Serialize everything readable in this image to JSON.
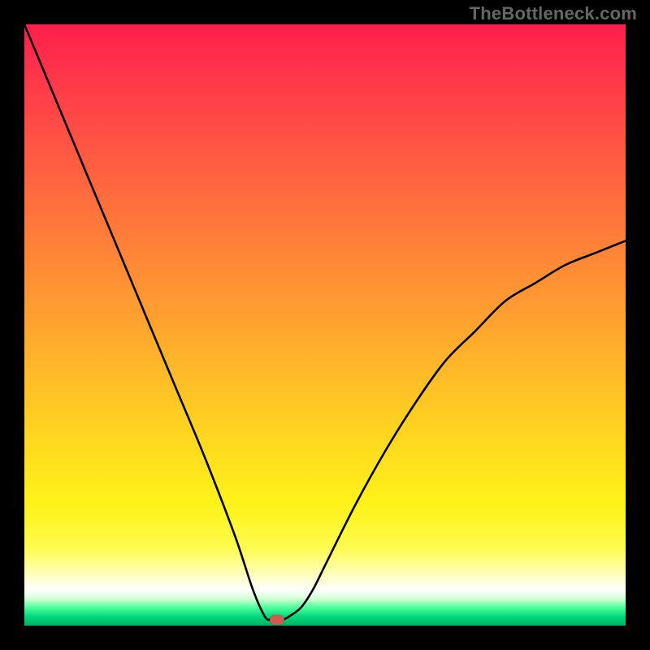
{
  "watermark": "TheBottleneck.com",
  "chart_data": {
    "type": "line",
    "title": "",
    "xlabel": "",
    "ylabel": "",
    "xlim": [
      0,
      100
    ],
    "ylim": [
      0,
      100
    ],
    "grid": false,
    "legend": false,
    "series": [
      {
        "name": "bottleneck-curve",
        "x": [
          0,
          5,
          10,
          15,
          20,
          25,
          30,
          35,
          38,
          40,
          41,
          42,
          43,
          44,
          46,
          48,
          50,
          55,
          60,
          65,
          70,
          75,
          80,
          85,
          90,
          95,
          100
        ],
        "values": [
          100,
          88,
          76,
          64,
          52,
          40,
          28,
          15,
          6,
          1.5,
          1,
          1,
          1,
          1.5,
          3,
          6,
          10,
          20,
          29,
          37,
          44,
          49,
          54,
          57,
          60,
          62,
          64
        ]
      }
    ],
    "marker": {
      "x": 42,
      "y": 1
    },
    "background_gradient": {
      "direction": "vertical",
      "stops": [
        {
          "pos": 0,
          "color": "#ff1f4d"
        },
        {
          "pos": 0.5,
          "color": "#ffa42f"
        },
        {
          "pos": 0.8,
          "color": "#fff31a"
        },
        {
          "pos": 0.94,
          "color": "#ffffff"
        },
        {
          "pos": 1.0,
          "color": "#00b060"
        }
      ]
    }
  }
}
